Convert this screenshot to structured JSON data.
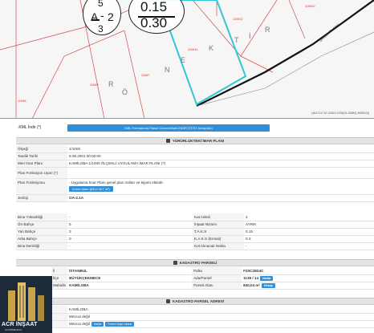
{
  "map": {
    "parcel_labels": [
      "1159/8",
      "1159/12",
      "1159/7",
      "1159/14",
      "1159/6",
      "1159/9",
      "1159/10"
    ],
    "street_letters": [
      "Ö",
      "R",
      "N",
      "E",
      "K",
      "T",
      "İ",
      "R"
    ],
    "road_label": "Şirindere Caddesi",
    "coords": "(4647417.87,40524.3705{24.29880},3605043)",
    "zoning": {
      "zone_top": "5",
      "zone_letter": "A",
      "zone_dash": "2",
      "zone_bottom": "3",
      "taks": "0.15",
      "kaks": "0.30"
    }
  },
  "kml": {
    "label": ".KML İndir (*)",
    "button": "KML Formatında Parsel Geometrisini İNDİR (TEST Amaçlıdır)"
  },
  "imar": {
    "title": "YÜRÜRLÜKTEKİ İMAR PLANI",
    "rows": [
      {
        "label": "Ölçeği",
        "value": "1/1000"
      },
      {
        "label": "Tasdik Tarihi",
        "value": "8.08.2001 00:00:00"
      },
      {
        "label": "Meri İmar Planı",
        "value": "KAMİLOBA 1/1000 ÖLÇEKLİ UYGULAMA İMAR PLANI (?)"
      }
    ],
    "fonksiyon_uyan_label": "Plan Fonksiyon Uyarı (*)",
    "fonksiyonu_label": "Plan Fonksiyonu",
    "fonksiyonu_value": "- Uygulama İmar Planı genel plan notları ve lejantı ektedir.",
    "konut_badge": "Konut Alanı (8412,407 m²)",
    "lejant_label": "Jeoloji",
    "lejant_value": "OA-2.1A"
  },
  "details_left": [
    {
      "label": "Bina Yüksekliği",
      "value": "-"
    },
    {
      "label": "Ön Bahçe",
      "value": "5"
    },
    {
      "label": "Yan Bahçe",
      "value": "3"
    },
    {
      "label": "Arka Bahçe",
      "value": "0"
    },
    {
      "label": "Bina Derinliği",
      "value": "-"
    }
  ],
  "details_right": [
    {
      "label": "Kat Adedi",
      "value": "2"
    },
    {
      "label": "İnşaat Nizamı",
      "value": "AYRIK"
    },
    {
      "label": "T.A.K.S",
      "value": "0.15"
    },
    {
      "label": "K.A.K.S (Emsal)",
      "value": "0.3"
    },
    {
      "label": "Kot Alınacak Nokta",
      "value": "-"
    }
  ],
  "kadastro": {
    "title": "KADASTRO PARSELİ",
    "rows": [
      {
        "label": "İl",
        "value": "İSTANBUL",
        "rlabel": "Pafta",
        "rvalue": "F20C20D4C"
      },
      {
        "label": "İlçe",
        "value": "BÜYÜKÇEKMECE",
        "rlabel": "Ada/Parsel",
        "rvalue": "1139 / 14"
      },
      {
        "label": "Mahalle",
        "value": "KAMİLOBA",
        "rlabel": "Parsel Alanı",
        "rvalue": "840,04 m²"
      }
    ],
    "btn_harita": "Harita",
    "btn_area": "Hesap",
    "btn_map": "Harita"
  },
  "adres": {
    "title": "KADASTRO PARSEL ADRESİ",
    "rows": [
      {
        "label": "Mahalle",
        "value": "KAMİLOBA"
      },
      {
        "label": "Cadde/Sokak",
        "value": "Mevcut değil"
      },
      {
        "label": "Kapı No",
        "value": "Mevcut değil"
      }
    ],
    "btn_harita": "Harita",
    "btn_plan": "Parsel Kapı Listesi"
  },
  "logo": {
    "name": "ACR İNŞAAT",
    "sub": "GAYRİMENKUL"
  },
  "watermark": "sahibinden.com",
  "colors": {
    "accent": "#2f8fd8",
    "parcel_highlight": "#34c6d4",
    "red_label": "#d0302c"
  }
}
